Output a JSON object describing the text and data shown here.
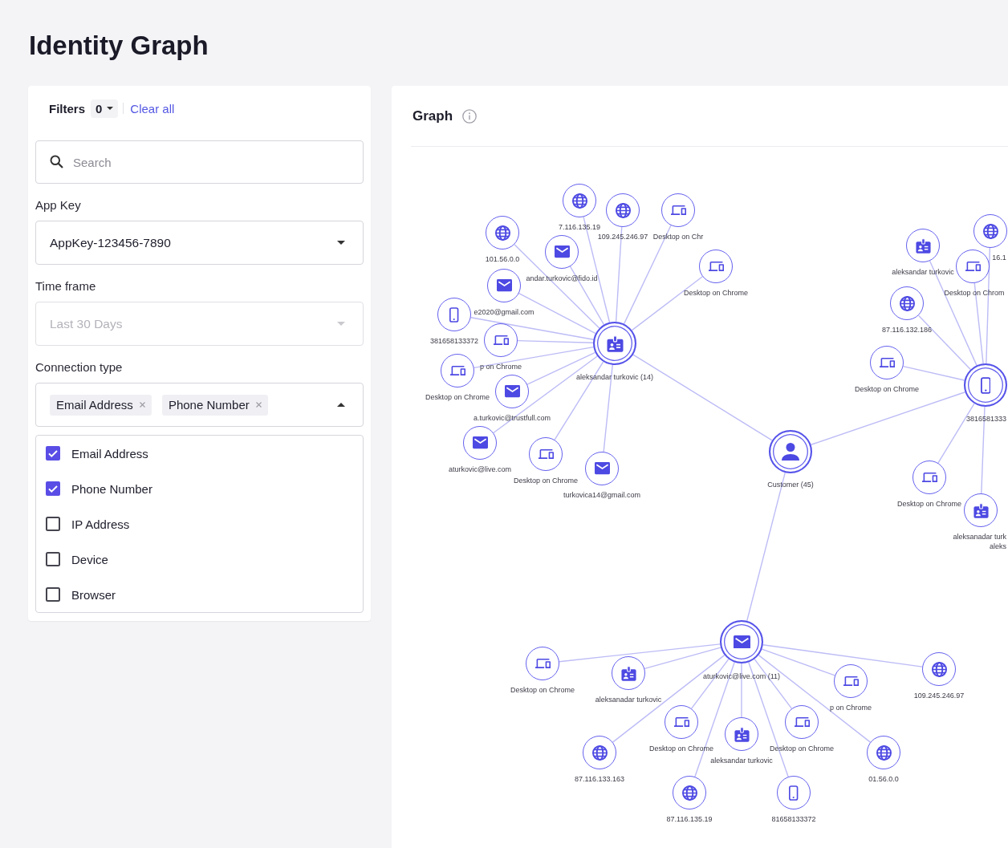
{
  "page": {
    "title": "Identity Graph"
  },
  "filters": {
    "title": "Filters",
    "count": "0",
    "clear_label": "Clear all",
    "search": {
      "placeholder": "Search"
    },
    "fields": [
      {
        "kind": "select",
        "label": "App Key",
        "value": "AppKey-123456-7890",
        "disabled": false,
        "expanded": false
      },
      {
        "kind": "select",
        "label": "Time frame",
        "value": "Last 30 Days",
        "disabled": true,
        "expanded": false
      },
      {
        "kind": "multiselect",
        "label": "Connection type",
        "chips": [
          "Email Address",
          "Phone Number"
        ],
        "disabled": false,
        "expanded": true,
        "options": [
          {
            "label": "Email Address",
            "checked": true
          },
          {
            "label": "Phone Number",
            "checked": true
          },
          {
            "label": "IP Address",
            "checked": false
          },
          {
            "label": "Device",
            "checked": false
          },
          {
            "label": "Browser",
            "checked": false
          }
        ]
      }
    ]
  },
  "graph": {
    "title": "Graph",
    "root": {
      "kind": "customer",
      "label": "Customer (45)"
    },
    "clusters": [
      {
        "hub": {
          "kind": "name",
          "label": "aleksandar turkovic (14)"
        },
        "nodes": [
          {
            "kind": "ip",
            "label": "7.116.135.19"
          },
          {
            "kind": "ip",
            "label": "109.245.246.97"
          },
          {
            "kind": "device",
            "label": "Desktop on Chr"
          },
          {
            "kind": "ip",
            "label": "101.56.0.0"
          },
          {
            "kind": "email",
            "label": "andar.turkovic@fido.id"
          },
          {
            "kind": "device",
            "label": "Desktop on Chrome"
          },
          {
            "kind": "email",
            "label": "e2020@gmail.com"
          },
          {
            "kind": "phone",
            "label": "381658133372"
          },
          {
            "kind": "device",
            "label": "p on Chrome"
          },
          {
            "kind": "device",
            "label": "Desktop on Chrome"
          },
          {
            "kind": "email",
            "label": "a.turkovic@trustfull.com"
          },
          {
            "kind": "email",
            "label": "aturkovic@live.com"
          },
          {
            "kind": "device",
            "label": "Desktop on Chrome"
          },
          {
            "kind": "email",
            "label": "turkovica14@gmail.com"
          }
        ]
      },
      {
        "hub": {
          "kind": "phone",
          "label": "3816581333"
        },
        "nodes": [
          {
            "kind": "ip",
            "label": "16.1"
          },
          {
            "kind": "name",
            "label": "aleksandar turkovic"
          },
          {
            "kind": "device",
            "label": "Desktop on Chrom"
          },
          {
            "kind": "ip",
            "label": "87.116.132.186"
          },
          {
            "kind": "device",
            "label": "Desktop on Chrome"
          },
          {
            "kind": "device",
            "label": "Desktop on Chrome"
          },
          {
            "kind": "name",
            "label": "aleksanadar turk",
            "second_line": "aleks"
          }
        ]
      },
      {
        "hub": {
          "kind": "email",
          "label": "aturkovic@live.com (11)"
        },
        "nodes": [
          {
            "kind": "device",
            "label": "Desktop on Chrome"
          },
          {
            "kind": "name",
            "label": "aleksanadar turkovic"
          },
          {
            "kind": "ip",
            "label": "87.116.133.163"
          },
          {
            "kind": "device",
            "label": "Desktop on Chrome"
          },
          {
            "kind": "ip",
            "label": "87.116.135.19"
          },
          {
            "kind": "name",
            "label": "aleksandar turkovic"
          },
          {
            "kind": "phone",
            "label": "81658133372"
          },
          {
            "kind": "device",
            "label": "Desktop on Chrome"
          },
          {
            "kind": "ip",
            "label": "01.56.0.0"
          },
          {
            "kind": "device",
            "label": "p on Chrome"
          },
          {
            "kind": "ip",
            "label": "109.245.246.97"
          }
        ]
      }
    ]
  }
}
